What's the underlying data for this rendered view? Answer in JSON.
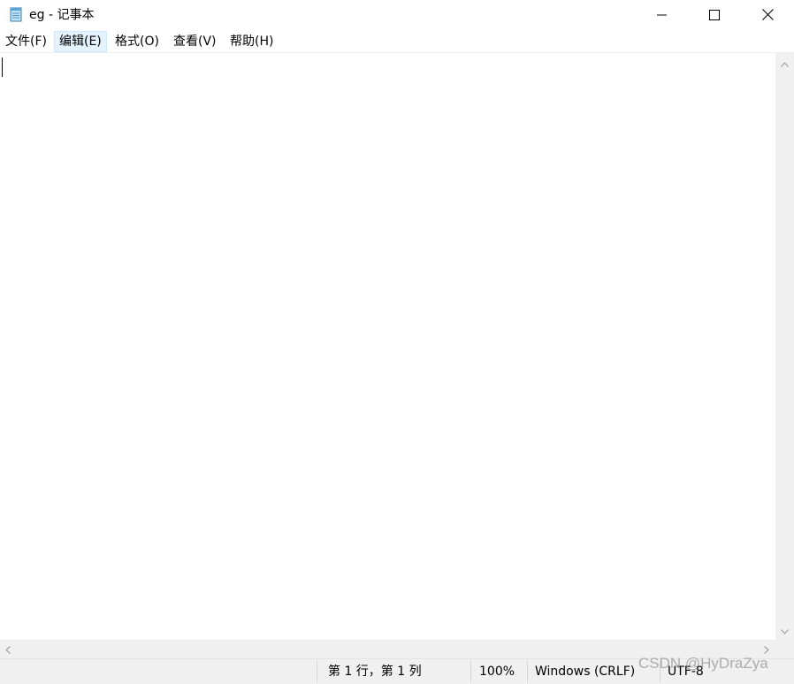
{
  "window": {
    "title": "eg - 记事本",
    "app_icon": "notepad-icon",
    "controls": {
      "minimize_icon": "minimize-icon",
      "maximize_icon": "maximize-icon",
      "close_icon": "close-icon"
    }
  },
  "menu": {
    "items": [
      {
        "label": "文件(F)"
      },
      {
        "label": "编辑(E)",
        "active": true
      },
      {
        "label": "格式(O)"
      },
      {
        "label": "查看(V)"
      },
      {
        "label": "帮助(H)"
      }
    ]
  },
  "editor": {
    "content": ""
  },
  "statusbar": {
    "position": "第 1 行，第 1 列",
    "zoom": "100%",
    "line_ending": "Windows (CRLF)",
    "encoding": "UTF-8"
  },
  "watermark": "CSDN @HyDraZya",
  "colors": {
    "active_menu_bg": "#e5f3ff",
    "chrome_bg": "#f0f0f0"
  }
}
